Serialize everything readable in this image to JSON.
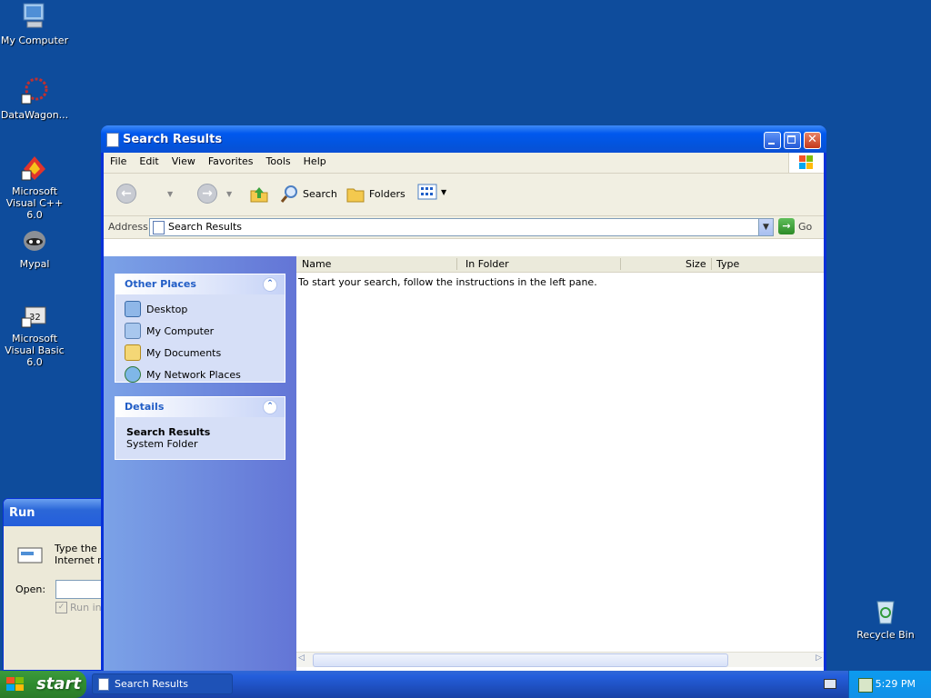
{
  "desktop": {
    "icons": [
      {
        "label": "My Computer"
      },
      {
        "label": "DataWagon..."
      },
      {
        "label": "Microsoft Visual C++ 6.0"
      },
      {
        "label": "Mypal"
      },
      {
        "label": "Microsoft Visual Basic 6.0"
      },
      {
        "label": "Recycle Bin"
      }
    ]
  },
  "run_dialog": {
    "title": "Run",
    "desc_line1": "Type the n",
    "desc_line2": "Internet re",
    "open_label": "Open:",
    "checkbox_label": "Run in s"
  },
  "window": {
    "title": "Search Results",
    "menu": [
      "File",
      "Edit",
      "View",
      "Favorites",
      "Tools",
      "Help"
    ],
    "toolbar": {
      "search": "Search",
      "folders": "Folders"
    },
    "address": {
      "label": "Address",
      "value": "Search Results",
      "go": "Go"
    },
    "left_pane": {
      "other_places": {
        "title": "Other Places",
        "items": [
          "Desktop",
          "My Computer",
          "My Documents",
          "My Network Places"
        ]
      },
      "details": {
        "title": "Details",
        "name": "Search Results",
        "type": "System Folder"
      }
    },
    "columns": [
      "Name",
      "In Folder",
      "Size",
      "Type"
    ],
    "message": "To start your search, follow the instructions in the left pane."
  },
  "taskbar": {
    "start": "start",
    "task_label": "Search Results",
    "clock": "5:29 PM"
  },
  "colors": {
    "desktop": "#0e4c9c",
    "title_blue": "#0058ee",
    "start_green": "#2f8c2f"
  }
}
